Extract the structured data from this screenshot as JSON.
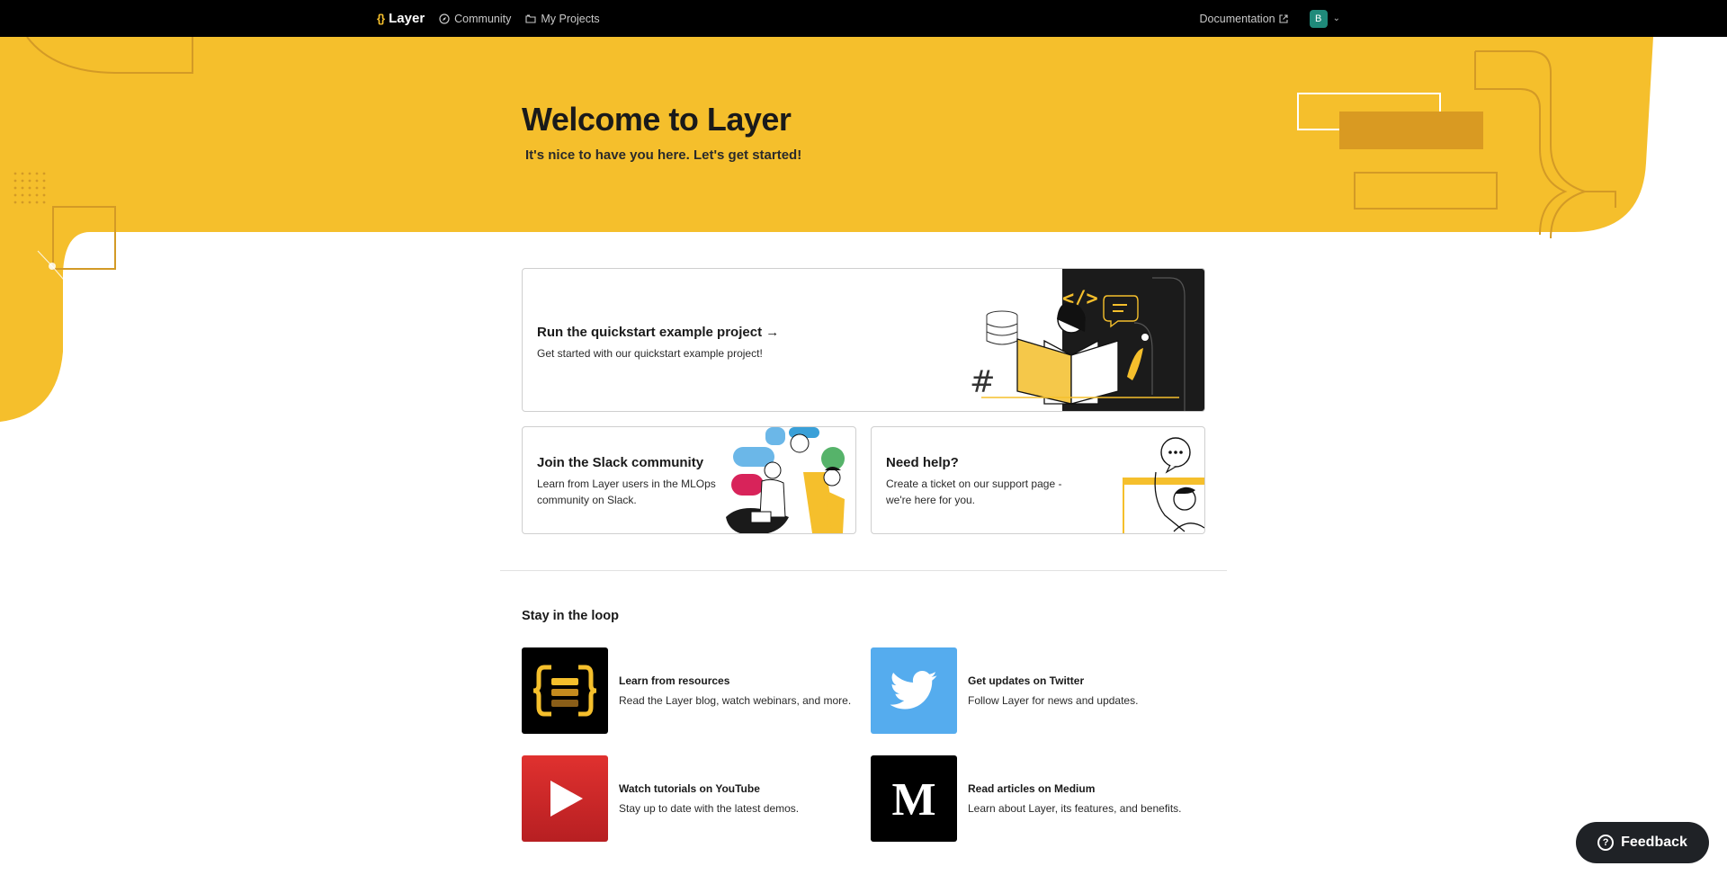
{
  "nav": {
    "brand": "Layer",
    "brand_icon": "{}",
    "community": "Community",
    "my_projects": "My Projects",
    "documentation": "Documentation",
    "avatar_initial": "B"
  },
  "hero": {
    "title": "Welcome to Layer",
    "subtitle": "It's nice to have you here. Let's get started!"
  },
  "cards": {
    "quickstart": {
      "title": "Run the quickstart example project →",
      "desc": "Get started with our quickstart example project!"
    },
    "slack": {
      "title": "Join the Slack community",
      "desc": "Learn from Layer users in the MLOps community on Slack."
    },
    "help": {
      "title": "Need help?",
      "desc": "Create a ticket on our support page - we're here for you."
    }
  },
  "loop": {
    "title": "Stay in the loop",
    "items": [
      {
        "title": "Learn from resources",
        "desc": "Read the Layer blog, watch webinars, and more.",
        "icon": "layer-logo-icon"
      },
      {
        "title": "Get updates on Twitter",
        "desc": "Follow Layer for news and updates.",
        "icon": "twitter-icon"
      },
      {
        "title": "Watch tutorials on YouTube",
        "desc": "Stay up to date with the latest demos.",
        "icon": "youtube-icon"
      },
      {
        "title": "Read articles on Medium",
        "desc": "Learn about Layer, its features, and benefits.",
        "icon": "medium-icon"
      }
    ]
  },
  "feedback": {
    "label": "Feedback"
  },
  "colors": {
    "brand_yellow": "#F5BF2C",
    "nav_bg": "#000000",
    "twitter_blue": "#55ACEE",
    "youtube_red": "#D4282A",
    "avatar_teal": "#1F8A7A"
  }
}
